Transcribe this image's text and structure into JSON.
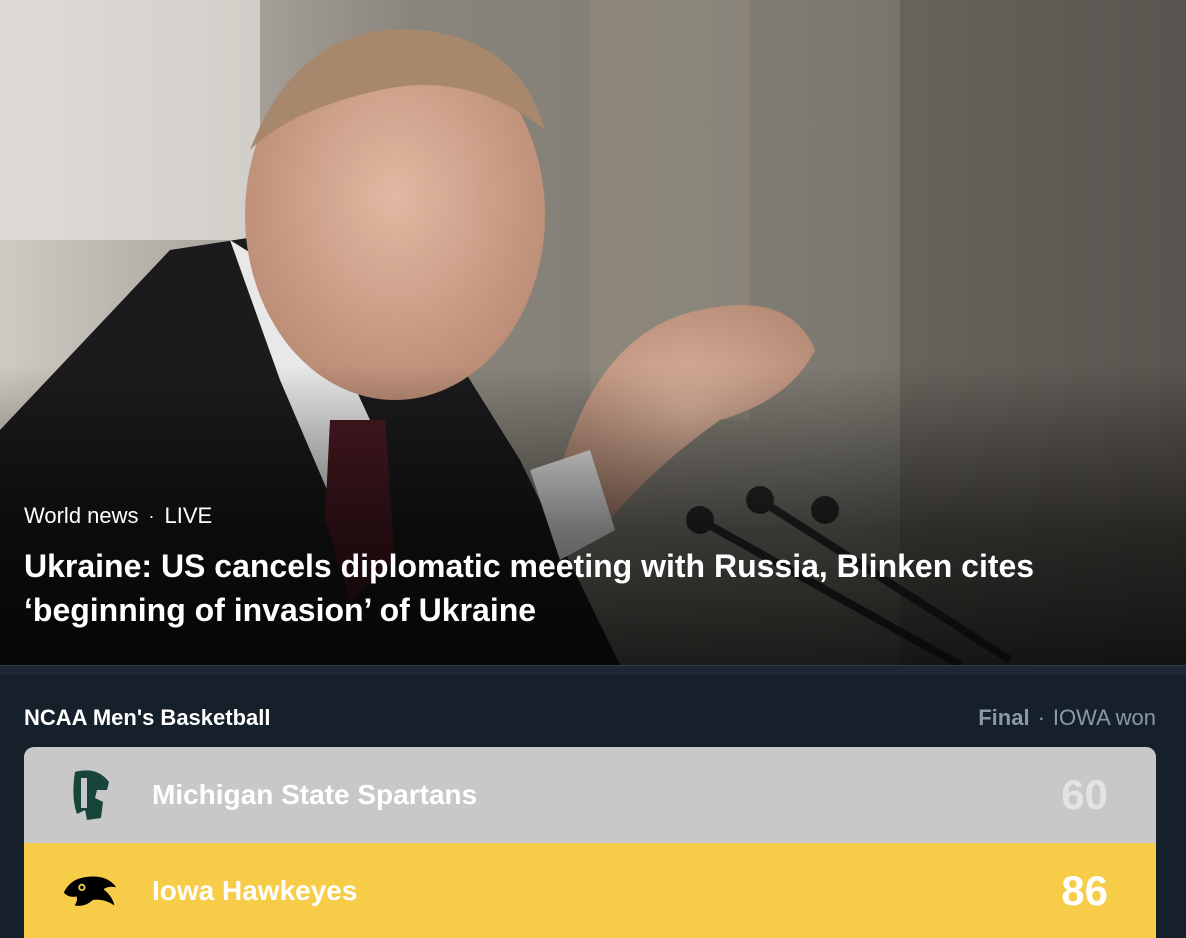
{
  "hero": {
    "category": "World news",
    "separator": "·",
    "badge": "LIVE",
    "headline": "Ukraine: US cancels diplomatic meeting with Russia, Blinken cites ‘beginning of invasion’ of Ukraine",
    "image_description_icon": "news-photo"
  },
  "scoreboard": {
    "league": "NCAA Men's Basketball",
    "status_final": "Final",
    "status_separator": "·",
    "status_result": "IOWA won",
    "teams": [
      {
        "name": "Michigan State Spartans",
        "score": "60",
        "logo_icon": "spartan-helmet-icon",
        "row_color": "#c8c8c8",
        "logo_color": "#18453b"
      },
      {
        "name": "Iowa Hawkeyes",
        "score": "86",
        "logo_icon": "hawkeye-icon",
        "row_color": "#f6cc48",
        "logo_color": "#000000"
      }
    ]
  }
}
